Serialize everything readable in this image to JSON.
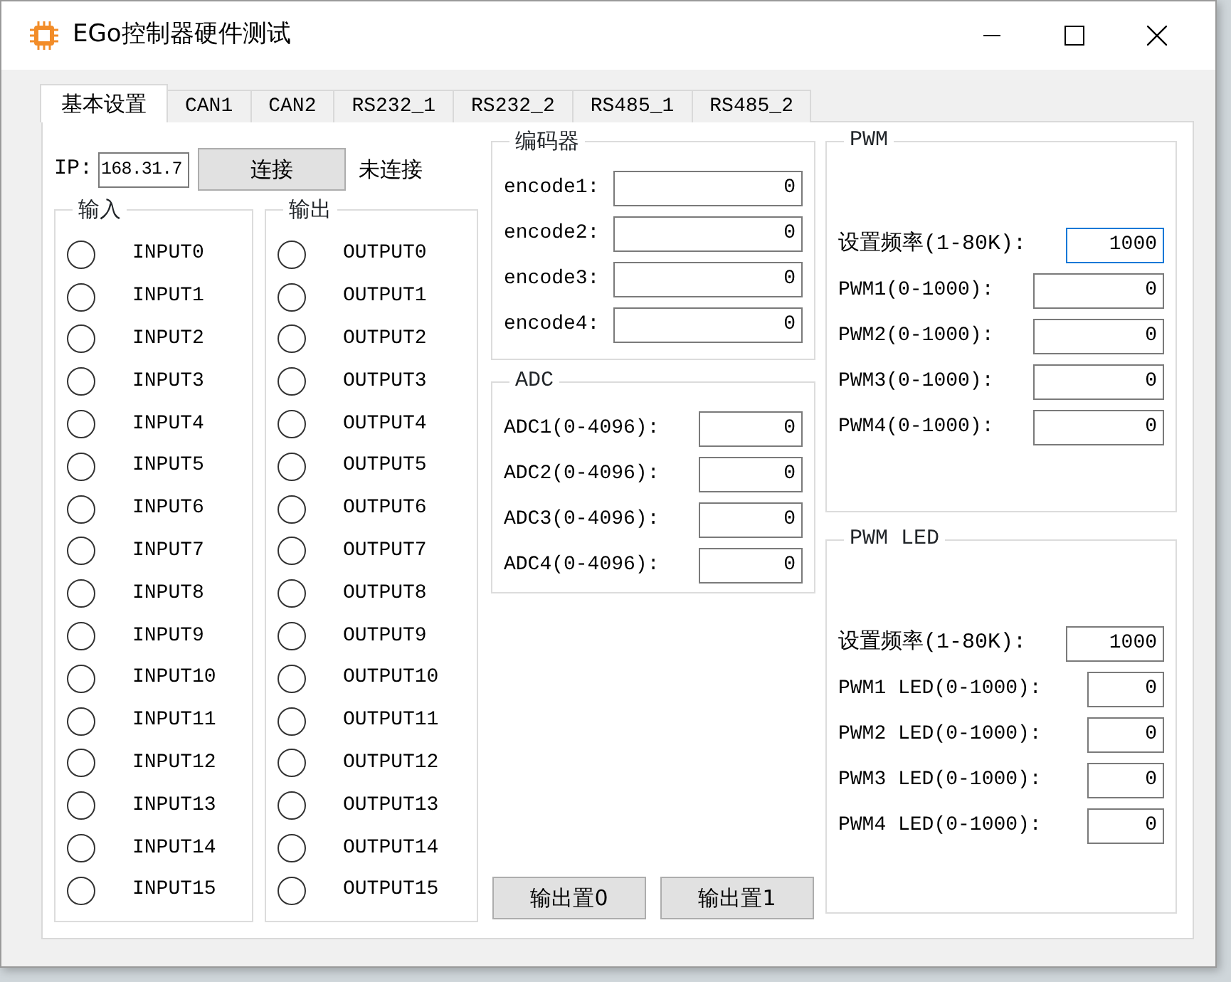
{
  "window": {
    "title": "EGo控制器硬件测试"
  },
  "tabs": [
    {
      "label": "基本设置",
      "selected": true
    },
    {
      "label": "CAN1",
      "selected": false
    },
    {
      "label": "CAN2",
      "selected": false
    },
    {
      "label": "RS232_1",
      "selected": false
    },
    {
      "label": "RS232_2",
      "selected": false
    },
    {
      "label": "RS485_1",
      "selected": false
    },
    {
      "label": "RS485_2",
      "selected": false
    }
  ],
  "connection": {
    "ip_label": "IP:",
    "ip_value": "168.31.7",
    "connect_button": "连接",
    "status": "未连接"
  },
  "inputs": {
    "title": "输入",
    "items": [
      {
        "label": "INPUT0",
        "on": false
      },
      {
        "label": "INPUT1",
        "on": false
      },
      {
        "label": "INPUT2",
        "on": false
      },
      {
        "label": "INPUT3",
        "on": false
      },
      {
        "label": "INPUT4",
        "on": false
      },
      {
        "label": "INPUT5",
        "on": false
      },
      {
        "label": "INPUT6",
        "on": false
      },
      {
        "label": "INPUT7",
        "on": false
      },
      {
        "label": "INPUT8",
        "on": false
      },
      {
        "label": "INPUT9",
        "on": false
      },
      {
        "label": "INPUT10",
        "on": false
      },
      {
        "label": "INPUT11",
        "on": false
      },
      {
        "label": "INPUT12",
        "on": false
      },
      {
        "label": "INPUT13",
        "on": false
      },
      {
        "label": "INPUT14",
        "on": false
      },
      {
        "label": "INPUT15",
        "on": false
      }
    ]
  },
  "outputs": {
    "title": "输出",
    "items": [
      {
        "label": "OUTPUT0",
        "on": false
      },
      {
        "label": "OUTPUT1",
        "on": false
      },
      {
        "label": "OUTPUT2",
        "on": false
      },
      {
        "label": "OUTPUT3",
        "on": false
      },
      {
        "label": "OUTPUT4",
        "on": false
      },
      {
        "label": "OUTPUT5",
        "on": false
      },
      {
        "label": "OUTPUT6",
        "on": false
      },
      {
        "label": "OUTPUT7",
        "on": false
      },
      {
        "label": "OUTPUT8",
        "on": false
      },
      {
        "label": "OUTPUT9",
        "on": false
      },
      {
        "label": "OUTPUT10",
        "on": false
      },
      {
        "label": "OUTPUT11",
        "on": false
      },
      {
        "label": "OUTPUT12",
        "on": false
      },
      {
        "label": "OUTPUT13",
        "on": false
      },
      {
        "label": "OUTPUT14",
        "on": false
      },
      {
        "label": "OUTPUT15",
        "on": false
      }
    ]
  },
  "encoder": {
    "title": "编码器",
    "fields": [
      {
        "label": "encode1:",
        "value": "0"
      },
      {
        "label": "encode2:",
        "value": "0"
      },
      {
        "label": "encode3:",
        "value": "0"
      },
      {
        "label": "encode4:",
        "value": "0"
      }
    ]
  },
  "adc": {
    "title": "ADC",
    "fields": [
      {
        "label": "ADC1(0-4096):",
        "value": "0"
      },
      {
        "label": "ADC2(0-4096):",
        "value": "0"
      },
      {
        "label": "ADC3(0-4096):",
        "value": "0"
      },
      {
        "label": "ADC4(0-4096):",
        "value": "0"
      }
    ]
  },
  "buttons": [
    "输出置0",
    "输出置1"
  ],
  "pwm": {
    "title": "PWM",
    "frequency": {
      "label": "设置频率(1-80K):",
      "value": "1000",
      "focused": true
    },
    "fields": [
      {
        "label": "PWM1(0-1000):",
        "value": "0"
      },
      {
        "label": "PWM2(0-1000):",
        "value": "0"
      },
      {
        "label": "PWM3(0-1000):",
        "value": "0"
      },
      {
        "label": "PWM4(0-1000):",
        "value": "0"
      }
    ]
  },
  "pwm_led": {
    "title": "PWM LED",
    "frequency": {
      "label": "设置频率(1-80K):",
      "value": "1000",
      "focused": false
    },
    "fields": [
      {
        "label": "PWM1 LED(0-1000):",
        "value": "0"
      },
      {
        "label": "PWM2 LED(0-1000):",
        "value": "0"
      },
      {
        "label": "PWM3 LED(0-1000):",
        "value": "0"
      },
      {
        "label": "PWM4 LED(0-1000):",
        "value": "0"
      }
    ]
  }
}
